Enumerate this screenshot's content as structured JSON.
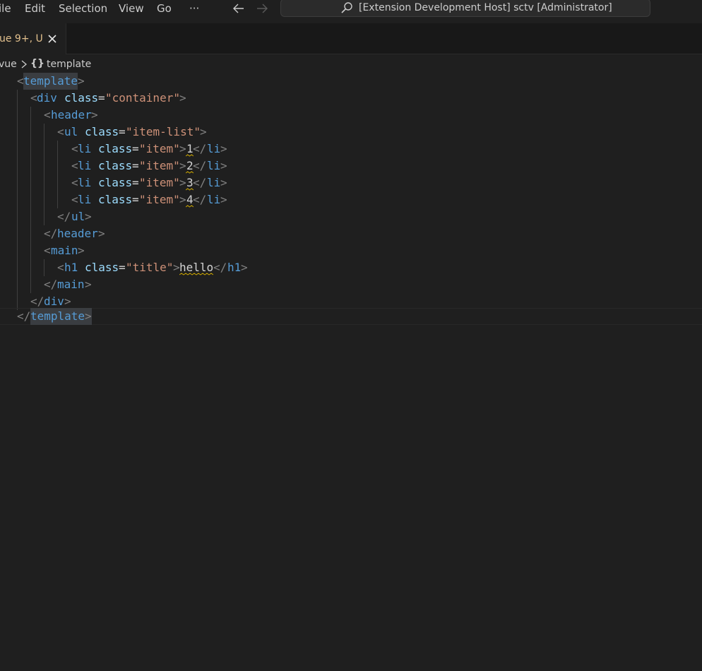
{
  "menu": {
    "file": "ile",
    "edit": "Edit",
    "selection": "Selection",
    "view": "View",
    "go": "Go",
    "more": "···"
  },
  "command_center": {
    "text": "[Extension Development Host] sctv [Administrator]"
  },
  "tab": {
    "label": "ue 9+, U",
    "modified_color": "#e2c08d"
  },
  "breadcrumb": {
    "file": "vue",
    "symbol_icon": "{}",
    "symbol": "template"
  },
  "code": {
    "lines": [
      {
        "t1": "<",
        "tag": "template",
        "t2": ">"
      },
      {
        "t1": "<",
        "tag": "div",
        "attr": "class",
        "eq": "=",
        "val": "\"container\"",
        "t2": ">"
      },
      {
        "t1": "<",
        "tag": "header",
        "t2": ">"
      },
      {
        "t1": "<",
        "tag": "ul",
        "attr": "class",
        "eq": "=",
        "val": "\"item-list\"",
        "t2": ">"
      },
      {
        "t1": "<",
        "tag": "li",
        "attr": "class",
        "eq": "=",
        "val": "\"item\"",
        "t2": ">",
        "content": "1",
        "c1": "</",
        "ctag": "li",
        "c2": ">"
      },
      {
        "t1": "<",
        "tag": "li",
        "attr": "class",
        "eq": "=",
        "val": "\"item\"",
        "t2": ">",
        "content": "2",
        "c1": "</",
        "ctag": "li",
        "c2": ">"
      },
      {
        "t1": "<",
        "tag": "li",
        "attr": "class",
        "eq": "=",
        "val": "\"item\"",
        "t2": ">",
        "content": "3",
        "c1": "</",
        "ctag": "li",
        "c2": ">"
      },
      {
        "t1": "<",
        "tag": "li",
        "attr": "class",
        "eq": "=",
        "val": "\"item\"",
        "t2": ">",
        "content": "4",
        "c1": "</",
        "ctag": "li",
        "c2": ">"
      },
      {
        "t1": "</",
        "tag": "ul",
        "t2": ">"
      },
      {
        "t1": "</",
        "tag": "header",
        "t2": ">"
      },
      {
        "t1": "<",
        "tag": "main",
        "t2": ">"
      },
      {
        "t1": "<",
        "tag": "h1",
        "attr": "class",
        "eq": "=",
        "val": "\"title\"",
        "t2": ">",
        "content": "hello",
        "c1": "</",
        "ctag": "h1",
        "c2": ">"
      },
      {
        "t1": "</",
        "tag": "main",
        "t2": ">"
      },
      {
        "t1": "</",
        "tag": "div",
        "t2": ">"
      },
      {
        "t1": "</",
        "tag": "template",
        "t2": ">"
      }
    ]
  },
  "colors": {
    "background": "#1f1f1f",
    "tag": "#569cd6",
    "attribute": "#9cdcfe",
    "string": "#ce9178",
    "punctuation": "#808080",
    "text": "#d4d4d4",
    "warning_squiggle": "#cca700"
  }
}
